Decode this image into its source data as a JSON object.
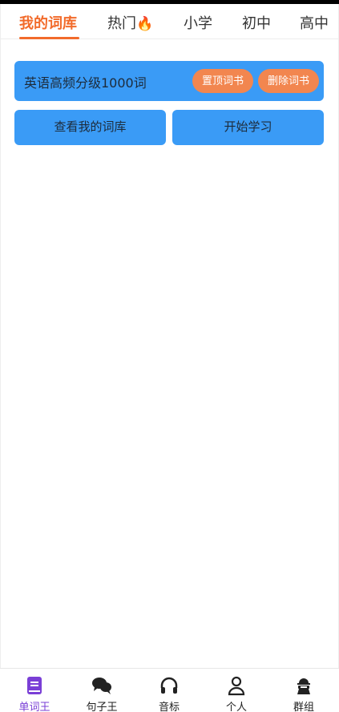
{
  "top_tabs": [
    {
      "label": "我的词库",
      "active": true
    },
    {
      "label": "热门",
      "icon": "fire-icon",
      "emoji": "🔥"
    },
    {
      "label": "小学"
    },
    {
      "label": "初中"
    },
    {
      "label": "高中"
    }
  ],
  "book": {
    "title": "英语高频分级1000词",
    "pin_label": "置顶词书",
    "delete_label": "删除词书"
  },
  "actions": {
    "view_label": "查看我的词库",
    "start_label": "开始学习"
  },
  "bottom_nav": [
    {
      "label": "单词王",
      "icon": "book-icon",
      "active": true
    },
    {
      "label": "句子王",
      "icon": "chat-bubbles-icon"
    },
    {
      "label": "音标",
      "icon": "headphones-icon"
    },
    {
      "label": "个人",
      "icon": "person-icon"
    },
    {
      "label": "群组",
      "icon": "group-icon"
    }
  ],
  "colors": {
    "accent_orange": "#f26b2b",
    "card_blue": "#3a9bf6",
    "pill_orange": "#f2864f",
    "active_purple": "#7a3fd6"
  }
}
